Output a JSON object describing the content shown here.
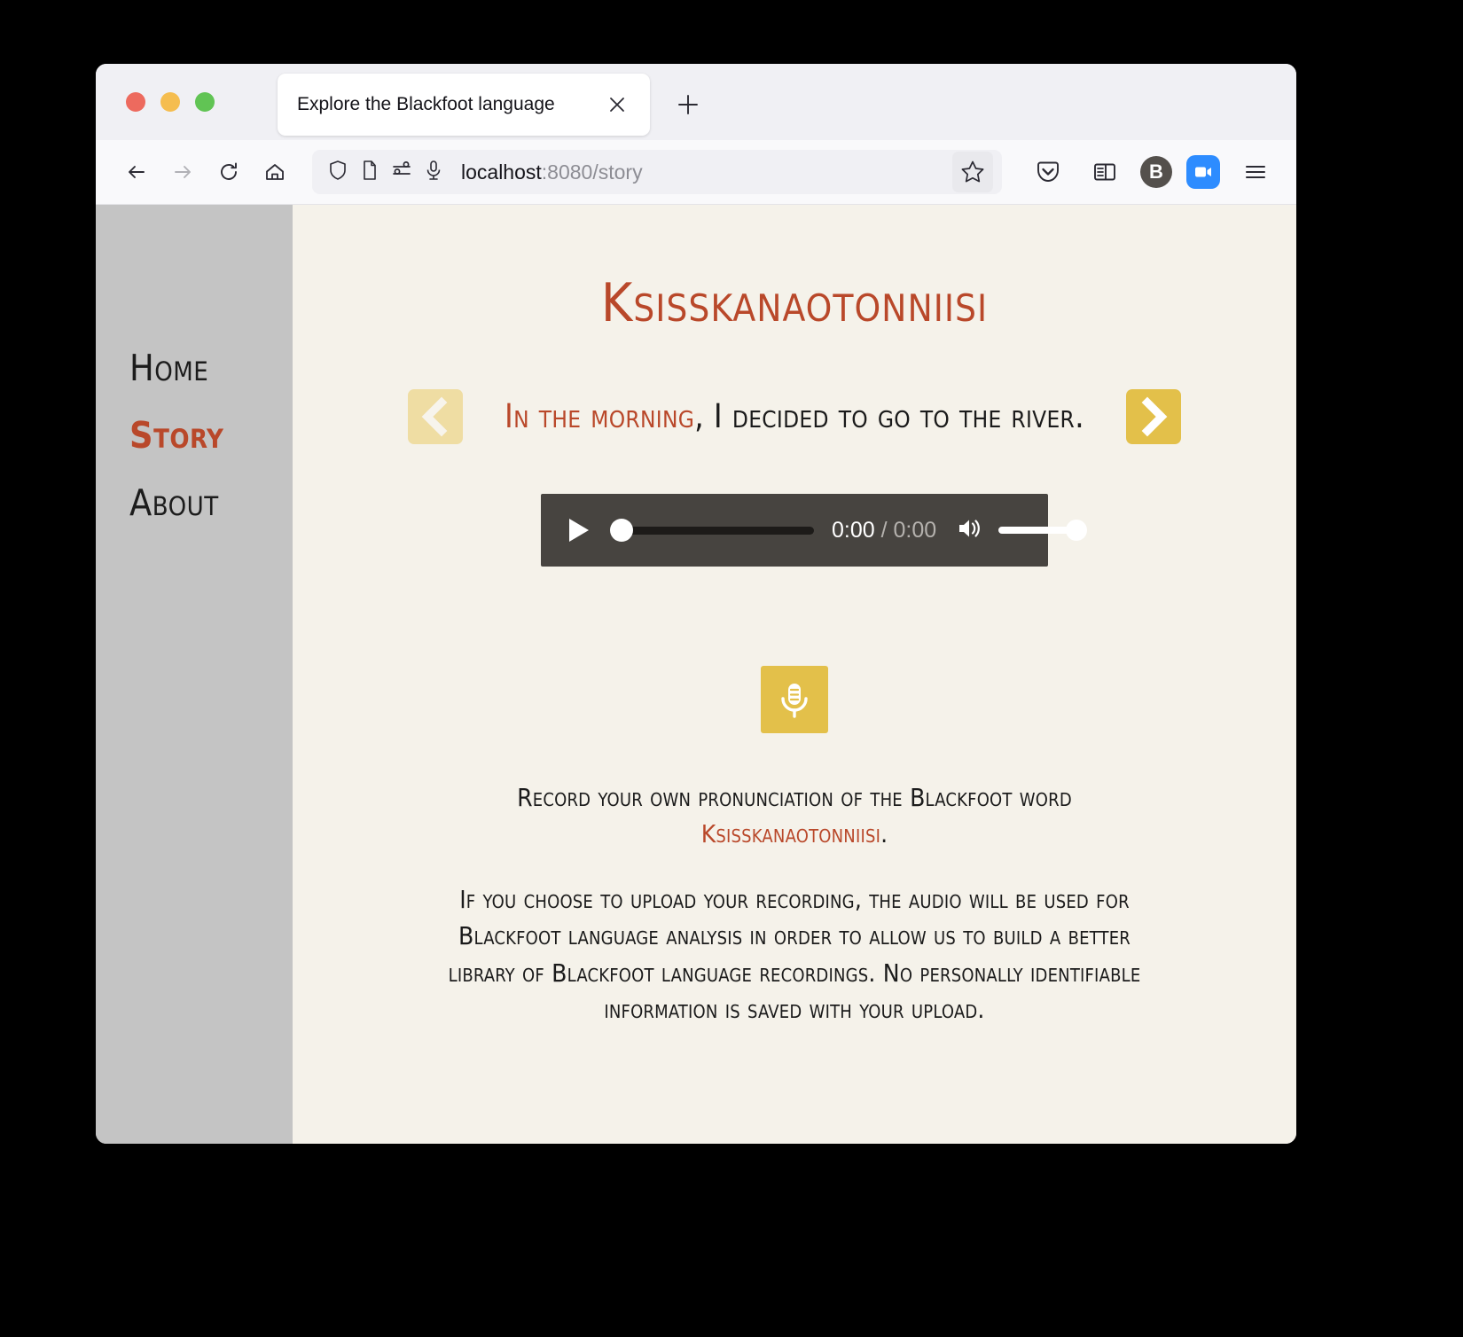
{
  "browser": {
    "tab": {
      "title": "Explore the Blackfoot language",
      "close_label": "×"
    },
    "new_tab_label": "+",
    "url": {
      "host": "localhost",
      "rest": ":8080/story",
      "full": "localhost:8080/story"
    },
    "toolbar_icons": [
      "back-icon",
      "forward-icon",
      "reload-icon",
      "home-icon"
    ],
    "urlbar_icons": [
      "shield-icon",
      "page-icon",
      "permissions-icon",
      "microphone-icon"
    ],
    "bookmark_icon": "star-icon",
    "extension_icons": [
      "pocket-icon",
      "sidebar-icon",
      "bitwarden-icon",
      "zoom-icon",
      "menu-icon"
    ],
    "bitwarden_label": "B"
  },
  "sidebar": {
    "items": [
      {
        "label": "Home",
        "active": false
      },
      {
        "label": "Story",
        "active": true
      },
      {
        "label": "About",
        "active": false
      }
    ]
  },
  "main": {
    "word_title": "Ksisskanaotonniisi",
    "sentence": {
      "highlight": "In the morning",
      "rest": ", I decided to go to the river."
    },
    "prev_label": "‹",
    "next_label": "›",
    "player": {
      "current_time": "0:00",
      "separator": " / ",
      "duration": "0:00",
      "progress_percent": 0,
      "volume_percent": 100,
      "state": "paused"
    },
    "record_button_icon": "microphone-icon",
    "info": {
      "line1_before": "Record your own pronunciation of the Blackfoot word ",
      "line1_word": "Ksisskanaotonniisi",
      "line1_after": ".",
      "line2": "If you choose to upload your recording, the audio will be used for Blackfoot language analysis in order to allow us to build a better library of Blackfoot language recordings. No personally identifiable information is saved with your upload."
    }
  },
  "colors": {
    "accent_red": "#b9482a",
    "gold": "#e3c04a",
    "gold_pale": "#efdda3",
    "page_bg": "#f5f2ea",
    "sidebar_bg": "#c4c4c4",
    "player_bg": "#474440"
  }
}
